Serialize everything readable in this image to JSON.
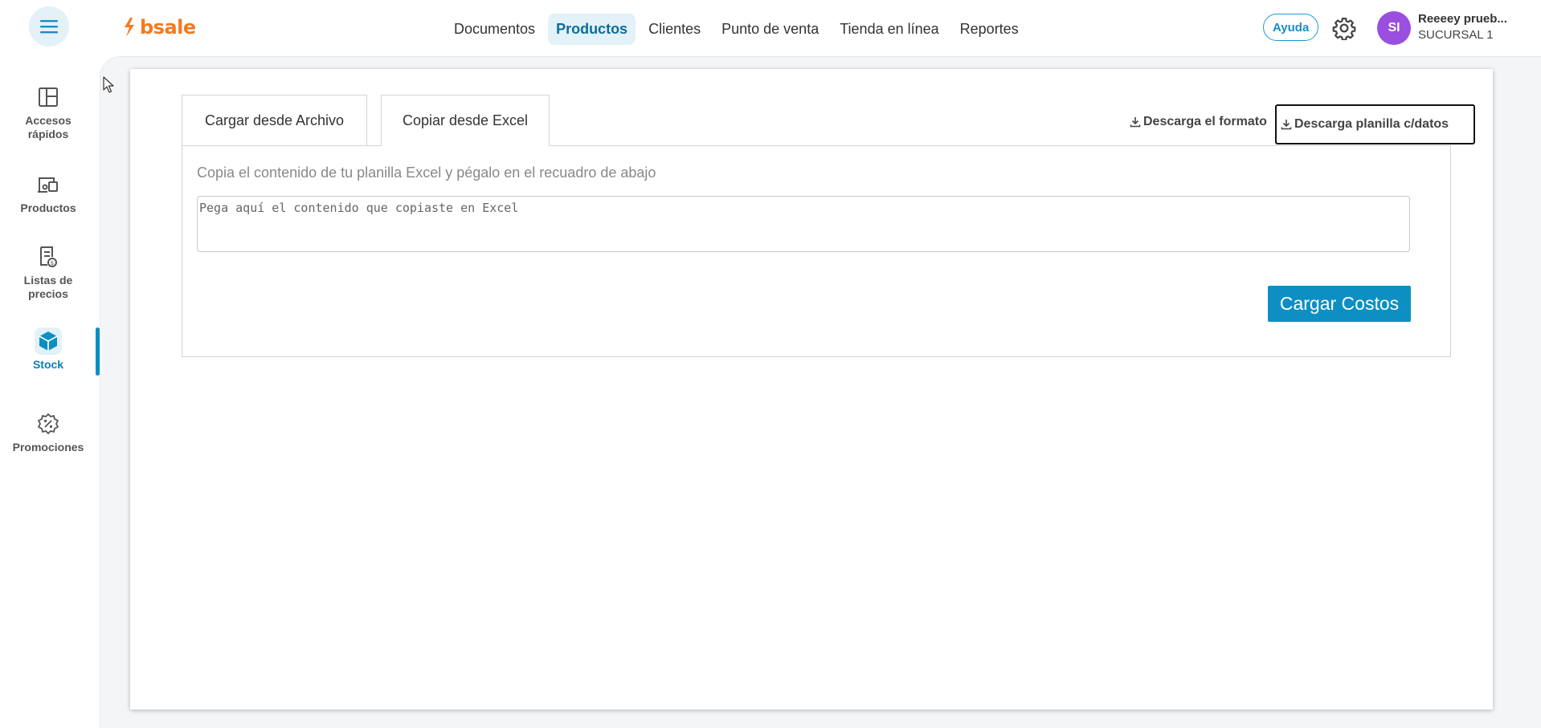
{
  "header": {
    "logo_text": "bsale",
    "nav": [
      {
        "label": "Documentos"
      },
      {
        "label": "Productos",
        "active": true
      },
      {
        "label": "Clientes"
      },
      {
        "label": "Punto de venta"
      },
      {
        "label": "Tienda en línea"
      },
      {
        "label": "Reportes"
      }
    ],
    "help_label": "Ayuda",
    "user": {
      "initials": "SI",
      "name": "Reeeey prueb...",
      "branch": "SUCURSAL 1"
    }
  },
  "sidebar": {
    "items": [
      {
        "label_1": "Accesos",
        "label_2": "rápidos",
        "icon": "layout-icon"
      },
      {
        "label_1": "Productos",
        "icon": "products-icon"
      },
      {
        "label_1": "Listas de",
        "label_2": "precios",
        "icon": "price-list-icon"
      },
      {
        "label_1": "Stock",
        "icon": "box-icon",
        "active": true
      },
      {
        "label_1": "Promociones",
        "icon": "promotion-badge-icon"
      }
    ]
  },
  "main": {
    "tabs": [
      {
        "label": "Cargar desde Archivo"
      },
      {
        "label": "Copiar desde Excel",
        "active": true
      }
    ],
    "download_format_label": "Descarga el formato",
    "download_data_label": "Descarga planilla c/datos",
    "instruction": "Copia el contenido de tu planilla Excel y pégalo en el recuadro de abajo",
    "paste_placeholder": "Pega aquí el contenido que copiaste en Excel",
    "paste_value": "",
    "submit_label": "Cargar Costos"
  },
  "colors": {
    "brand_orange": "#f47a20",
    "accent_blue": "#0d8fc4",
    "active_nav_bg": "#e3f1f8",
    "avatar": "#9a4fe0"
  }
}
